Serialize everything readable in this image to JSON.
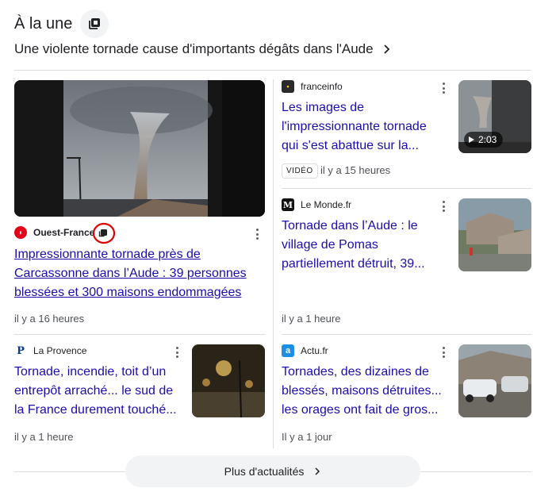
{
  "header": {
    "title": "À la une",
    "subtitle": "Une violente tornade cause d'importants dégâts dans l'Aude"
  },
  "articles": [
    {
      "source": "Ouest-France",
      "headline_lines": [
        "Impressionnante tornade près de",
        "Carcassonne dans l’Aude : 39 personnes",
        "blessées et 300 maisons endommagées"
      ],
      "time": "il y a 16 heures"
    },
    {
      "source": "franceinfo",
      "headline_lines": [
        "Les images de",
        "l'impressionnante tornade",
        "qui s'est abattue sur la..."
      ],
      "badge": "VIDÉO",
      "time": "il y a 15 heures",
      "video_duration": "2:03"
    },
    {
      "source": "Le Monde.fr",
      "headline_lines": [
        "Tornade dans l’Aude : le",
        "village de Pomas",
        "partiellement détruit, 39..."
      ],
      "time": "il y a 1 heure"
    },
    {
      "source": "La Provence",
      "headline_lines": [
        "Tornade, incendie, toit d’un",
        "entrepôt arraché... le sud de",
        "la France durement touché..."
      ],
      "time": "il y a 1 heure"
    },
    {
      "source": "Actu.fr",
      "headline_lines": [
        "Tornades, des dizaines de",
        "blessés, maisons détruites...",
        "les orages ont fait de gros..."
      ],
      "time": "Il y a 1 jour"
    }
  ],
  "footer": {
    "more_label": "Plus d'actualités"
  },
  "colors": {
    "link": "#1a0dab",
    "ouest_france": "#e2001a",
    "annotation_circle": "#e00000"
  },
  "icons": [
    "stack-icon",
    "chevron-right-icon",
    "more-vert-icon",
    "play-icon"
  ]
}
